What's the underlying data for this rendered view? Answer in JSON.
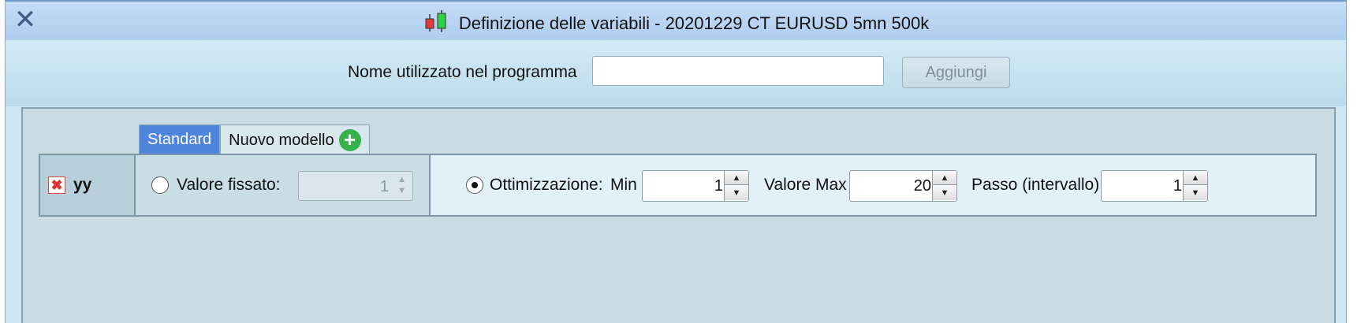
{
  "window": {
    "title": "Definizione delle variabili - 20201229 CT EURUSD 5mn 500k",
    "close_icon": "close-icon",
    "title_icon": "candlestick-icon"
  },
  "name_bar": {
    "label": "Nome utilizzato nel programma",
    "input_value": "",
    "add_label": "Aggiungi"
  },
  "tabs": [
    {
      "label": "Standard",
      "selected": true
    },
    {
      "label": "Nuovo modello",
      "icon": "plus-circle-icon"
    }
  ],
  "variable": {
    "name": "yy",
    "fixed": {
      "label": "Valore fissato:",
      "value": "1",
      "selected": false
    },
    "optimization": {
      "label": "Ottimizzazione:",
      "selected": true,
      "min_label": "Min",
      "min_value": "1",
      "max_label": "Valore Max",
      "max_value": "20",
      "step_label": "Passo (intervallo)",
      "step_value": "1"
    }
  },
  "colors": {
    "tab_selected": "#4d86dc",
    "add_icon": "#36b14c",
    "delete_icon": "#e03030"
  }
}
